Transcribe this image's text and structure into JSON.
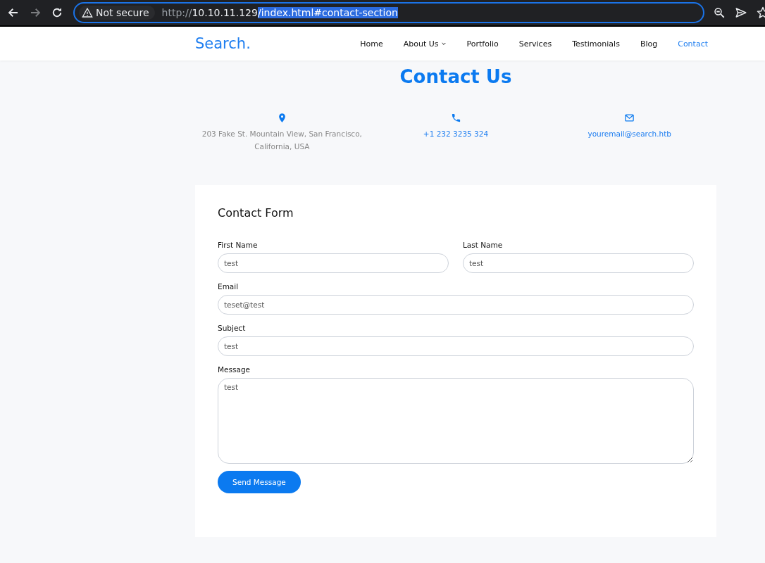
{
  "browser": {
    "back_disabled": false,
    "forward_disabled": true,
    "security": "Not secure",
    "url": {
      "scheme": "http://",
      "host": "10.10.11.129",
      "path": "/index.html#contact-section",
      "path_selected": true
    }
  },
  "nav": {
    "logo": "Search.",
    "items": [
      {
        "label": "Home",
        "selected": false,
        "dropdown": false
      },
      {
        "label": "About Us",
        "selected": false,
        "dropdown": true
      },
      {
        "label": "Portfolio",
        "selected": false,
        "dropdown": false
      },
      {
        "label": "Services",
        "selected": false,
        "dropdown": false
      },
      {
        "label": "Testimonials",
        "selected": false,
        "dropdown": false
      },
      {
        "label": "Blog",
        "selected": false,
        "dropdown": false
      },
      {
        "label": "Contact",
        "selected": true,
        "dropdown": false
      }
    ]
  },
  "heading": "Contact Us",
  "contacts": [
    {
      "kind": "address",
      "text": "203 Fake St. Mountain View, San Francisco, California, USA"
    },
    {
      "kind": "phone",
      "text": "+1 232 3235 324"
    },
    {
      "kind": "email",
      "text": "youremail@search.htb"
    }
  ],
  "form": {
    "title": "Contact Form",
    "fields": [
      {
        "kind": "input",
        "half_width": true,
        "label": "First Name",
        "value": "test"
      },
      {
        "kind": "input",
        "half_width": true,
        "label": "Last Name",
        "value": "test"
      },
      {
        "kind": "input",
        "half_width": false,
        "label": "Email",
        "value": "teset@test"
      },
      {
        "kind": "input",
        "half_width": false,
        "label": "Subject",
        "value": "test"
      },
      {
        "kind": "textarea",
        "half_width": false,
        "label": "Message",
        "value": "test"
      }
    ],
    "submit": "Send Message"
  }
}
